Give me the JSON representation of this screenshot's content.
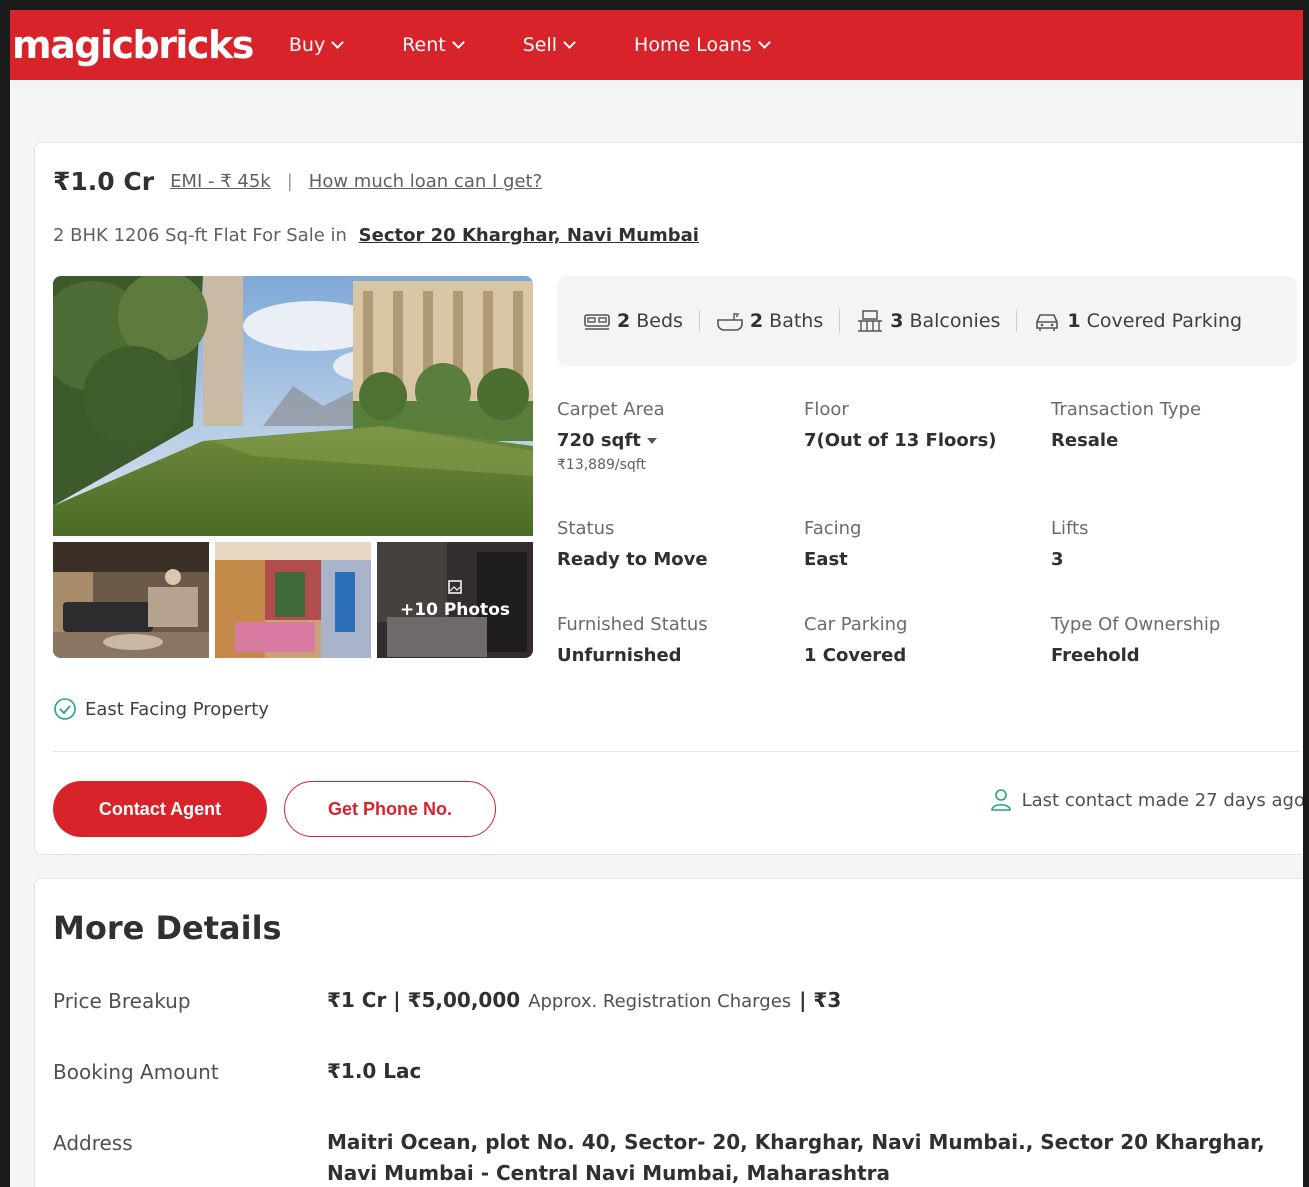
{
  "header": {
    "logo": "magicbricks",
    "nav": [
      {
        "label": "Buy"
      },
      {
        "label": "Rent"
      },
      {
        "label": "Sell"
      },
      {
        "label": "Home Loans"
      }
    ]
  },
  "listing": {
    "price": "₹1.0 Cr",
    "emi": "EMI - ₹ 45k",
    "separator": "|",
    "loan_link": "How much loan can I get?",
    "title_prefix": "2 BHK 1206 Sq-ft Flat For Sale in",
    "location": "Sector 20 Kharghar, Navi Mumbai",
    "photos_more": "+10 Photos",
    "amenities": [
      {
        "count": "2",
        "label": "Beds",
        "icon": "bed-icon"
      },
      {
        "count": "2",
        "label": "Baths",
        "icon": "bath-icon"
      },
      {
        "count": "3",
        "label": "Balconies",
        "icon": "balcony-icon"
      },
      {
        "count": "1",
        "label": "Covered Parking",
        "icon": "car-icon"
      }
    ],
    "specs": {
      "carpet_area": {
        "label": "Carpet Area",
        "value": "720 sqft",
        "sub": "₹13,889/sqft"
      },
      "floor": {
        "label": "Floor",
        "value": "7(Out of 13 Floors)"
      },
      "transaction": {
        "label": "Transaction Type",
        "value": "Resale"
      },
      "status": {
        "label": "Status",
        "value": "Ready to Move"
      },
      "facing": {
        "label": "Facing",
        "value": "East"
      },
      "lifts": {
        "label": "Lifts",
        "value": "3"
      },
      "furnished": {
        "label": "Furnished Status",
        "value": "Unfurnished"
      },
      "car_parking": {
        "label": "Car Parking",
        "value": "1 Covered"
      },
      "ownership": {
        "label": "Type Of Ownership",
        "value": "Freehold"
      }
    },
    "highlight": "East Facing Property",
    "contact_button": "Contact Agent",
    "phone_button": "Get Phone No.",
    "last_contact": "Last contact made 27 days ago"
  },
  "more_details": {
    "title": "More Details",
    "price_breakup": {
      "label": "Price Breakup",
      "value_a": "₹1 Cr | ₹5,00,000",
      "value_b": "Approx. Registration Charges",
      "value_c": "| ₹3"
    },
    "booking": {
      "label": "Booking Amount",
      "value": "₹1.0 Lac"
    },
    "address": {
      "label": "Address",
      "value": "Maitri Ocean, plot No. 40, Sector- 20, Kharghar, Navi Mumbai., Sector 20 Kharghar, Navi Mumbai - Central Navi Mumbai, Maharashtra"
    }
  },
  "colors": {
    "brand": "#d8232a",
    "accent_green": "#2aa37a"
  }
}
